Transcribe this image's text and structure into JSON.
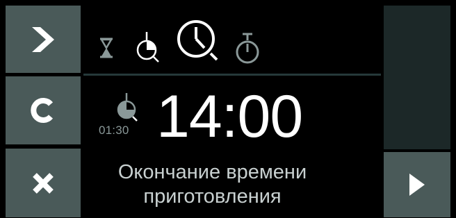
{
  "panel": {
    "duration": "01:30",
    "end_time": "14:00",
    "caption_line1": "Окончание времени",
    "caption_line2": "приготовления"
  },
  "left_buttons": [
    {
      "name": "next",
      "icon": "chevron-right-icon"
    },
    {
      "name": "clear",
      "icon": "letter-c-icon"
    },
    {
      "name": "close",
      "icon": "x-icon"
    }
  ],
  "top_icons": [
    {
      "name": "hourglass-icon",
      "state": "inactive"
    },
    {
      "name": "clock-start-icon",
      "state": "inactive"
    },
    {
      "name": "clock-end-icon",
      "state": "selected"
    },
    {
      "name": "stopwatch-icon",
      "state": "inactive"
    }
  ],
  "right_button": {
    "icon": "play-icon"
  },
  "colors": {
    "button_bg": "#4a5a59",
    "button_icon": "#ffffff",
    "panel_bg": "#000000",
    "right_panel_bg": "#1c2828",
    "divider": "#26393a",
    "inactive_icon": "#8a9898",
    "text_primary": "#ffffff",
    "text_secondary": "#c8d0d0"
  }
}
